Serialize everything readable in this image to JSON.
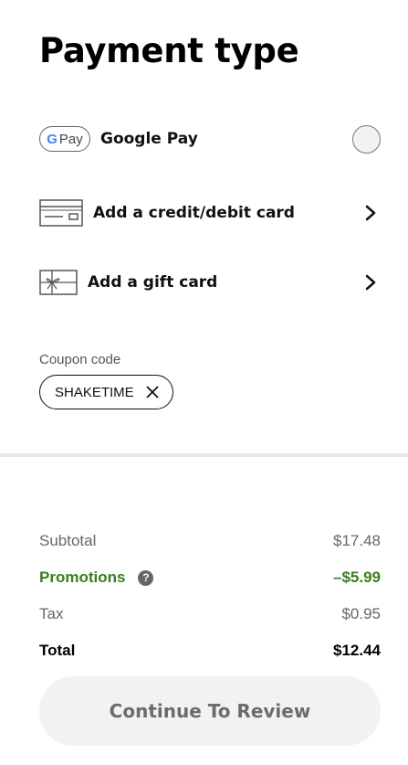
{
  "page": {
    "title": "Payment type"
  },
  "payment_methods": [
    {
      "label": "Google Pay",
      "badge": "Pay",
      "badge_g": "G",
      "icon": "google-pay-icon",
      "control": "radio",
      "selected": false
    },
    {
      "label": "Add a credit/debit card",
      "icon": "credit-card-icon",
      "control": "chevron-right"
    },
    {
      "label": "Add a gift card",
      "icon": "gift-card-icon",
      "control": "chevron-right"
    }
  ],
  "coupon": {
    "label": "Coupon code",
    "code": "SHAKETIME",
    "remove_icon": "close-icon"
  },
  "summary": {
    "subtotal": {
      "label": "Subtotal",
      "value": "$17.48"
    },
    "promotions": {
      "label": "Promotions",
      "value": "–$5.99",
      "help_icon": "?"
    },
    "tax": {
      "label": "Tax",
      "value": "$0.95"
    },
    "total": {
      "label": "Total",
      "value": "$12.44"
    }
  },
  "cta": {
    "label": "Continue To Review"
  },
  "colors": {
    "promo_green": "#3b7d1f",
    "cta_bg": "#f2f2f2",
    "cta_text": "#6b6b6b"
  }
}
